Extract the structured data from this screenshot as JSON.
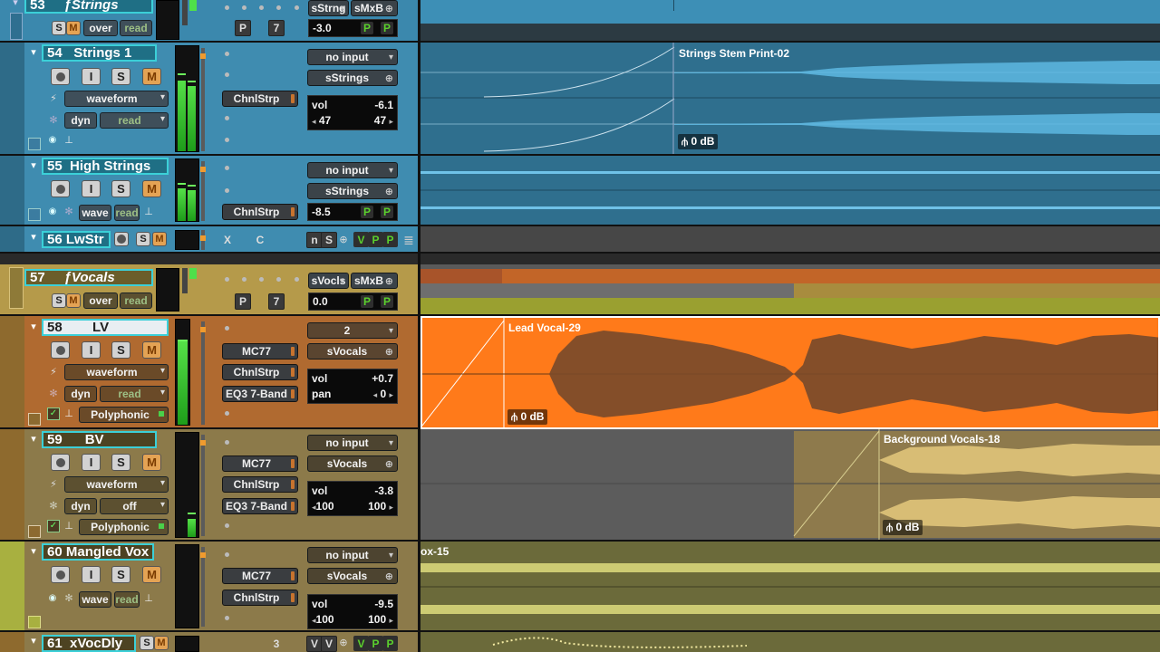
{
  "tracks": {
    "t53": {
      "number": "53",
      "name": "ƒStrings",
      "solo": "S",
      "mute": "M",
      "mode": "over",
      "auto": "read",
      "input": "sStrng",
      "output": "sMxB",
      "pan_label": "P",
      "pan_value": "7",
      "volume": "-3.0",
      "pbtn1": "P",
      "pbtn2": "P"
    },
    "t54": {
      "number": "54",
      "name": "Strings 1",
      "input_btn": "I",
      "solo": "S",
      "mute": "M",
      "view": "waveform",
      "auto_label": "dyn",
      "auto": "read",
      "insert1": "ChnlStrp",
      "io_in": "no input",
      "io_out": "sStrings",
      "vol_label": "vol",
      "vol_value": "-6.1",
      "pan_l": "47",
      "pan_r": "47",
      "clip_name": "Strings Stem Print-02",
      "clip_gain": "0 dB"
    },
    "t55": {
      "number": "55",
      "name": "High Strings",
      "input_btn": "I",
      "solo": "S",
      "mute": "M",
      "view": "wave",
      "auto": "read",
      "insert1": "ChnlStrp",
      "io_in": "no input",
      "io_out": "sStrings",
      "volume": "-8.5",
      "pbtn1": "P",
      "pbtn2": "P"
    },
    "t56": {
      "number": "56",
      "name": "LwStr",
      "solo": "S",
      "mute": "M",
      "x": "X",
      "c": "C",
      "n": "n",
      "s": "S",
      "v": "V",
      "p1": "P",
      "p2": "P"
    },
    "t57": {
      "number": "57",
      "name": "ƒVocals",
      "solo": "S",
      "mute": "M",
      "mode": "over",
      "auto": "read",
      "input": "sVocls",
      "output": "sMxB",
      "pan_label": "P",
      "pan_value": "7",
      "volume": "0.0",
      "pbtn1": "P",
      "pbtn2": "P"
    },
    "t58": {
      "number": "58",
      "name": "LV",
      "input_btn": "I",
      "solo": "S",
      "mute": "M",
      "view": "waveform",
      "auto_label": "dyn",
      "auto": "read",
      "elastic": "Polyphonic",
      "insert1": "MC77",
      "insert2": "ChnlStrp",
      "insert3": "EQ3 7-Band",
      "io_in": "2",
      "io_out": "sVocals",
      "vol_label": "vol",
      "vol_value": "+0.7",
      "pan_label": "pan",
      "pan_value": "0",
      "clip_name": "Lead Vocal-29",
      "clip_gain": "0 dB"
    },
    "t59": {
      "number": "59",
      "name": "BV",
      "input_btn": "I",
      "solo": "S",
      "mute": "M",
      "view": "waveform",
      "auto_label": "dyn",
      "auto": "off",
      "elastic": "Polyphonic",
      "insert1": "MC77",
      "insert2": "ChnlStrp",
      "insert3": "EQ3 7-Band",
      "io_in": "no input",
      "io_out": "sVocals",
      "vol_label": "vol",
      "vol_value": "-3.8",
      "pan_l": "100",
      "pan_r": "100",
      "clip_name": "Background Vocals-18",
      "clip_gain": "0 dB"
    },
    "t60": {
      "number": "60",
      "name": "Mangled Vox",
      "input_btn": "I",
      "solo": "S",
      "mute": "M",
      "view": "wave",
      "auto": "read",
      "insert1": "MC77",
      "insert2": "ChnlStrp",
      "io_in": "no input",
      "io_out": "sVocals",
      "vol_label": "vol",
      "vol_value": "-9.5",
      "pan_l": "100",
      "pan_r": "100",
      "clip_name": "ox-15"
    },
    "t61": {
      "number": "61",
      "name": "xVocDly",
      "solo": "S",
      "mute": "M",
      "three": "3",
      "v1": "V",
      "v2": "V",
      "p1": "P",
      "p2": "P"
    }
  },
  "colors": {
    "strings_blue": "#3d8fb6",
    "strings_clip": "#2f6f8e",
    "vocals_orange": "#ff7a1a",
    "bv_olive": "#8c7a4a",
    "mangled_yellow": "#b2b04a",
    "teal_selection": "#3bd0d8",
    "meter_green": "#4ed83e"
  }
}
